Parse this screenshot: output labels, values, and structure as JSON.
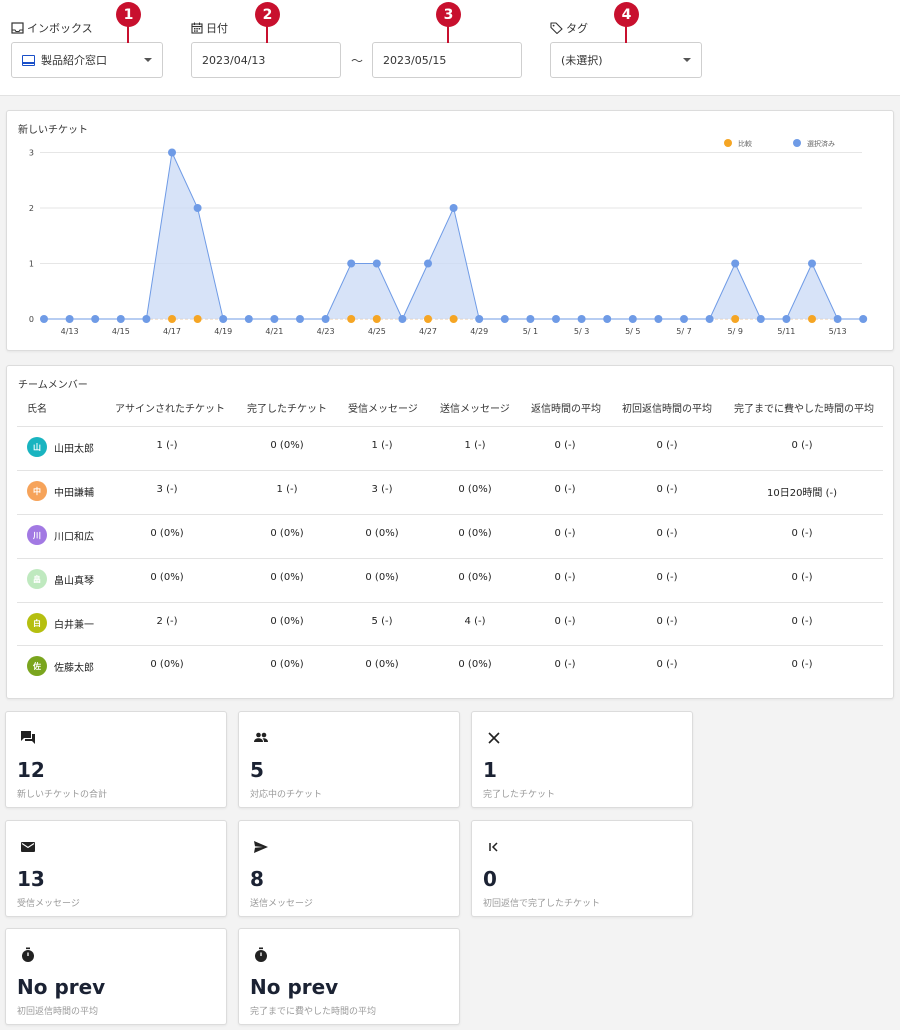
{
  "filters": {
    "inbox": {
      "label": "インボックス",
      "value": "製品紹介窓口",
      "badge": "1"
    },
    "date": {
      "label": "日付",
      "from": "2023/04/13",
      "to": "2023/05/15",
      "separator": "～",
      "badge_from": "2",
      "badge_to": "3"
    },
    "tag": {
      "label": "タグ",
      "value": "(未選択)",
      "badge": "4"
    },
    "badge_color": "#c8102e"
  },
  "chart": {
    "title": "新しいチケット",
    "legend": {
      "compare": "比較",
      "selected": "選択済み"
    },
    "colors": {
      "selected": "#6f9be6",
      "compare": "#f5a524",
      "fill": "#c9d9f5"
    }
  },
  "chart_data": {
    "type": "area",
    "x": [
      "4/13",
      "4/14",
      "4/15",
      "4/16",
      "4/17",
      "4/18",
      "4/19",
      "4/20",
      "4/21",
      "4/22",
      "4/23",
      "4/24",
      "4/25",
      "4/26",
      "4/27",
      "4/28",
      "4/29",
      "4/30",
      "5/1",
      "5/2",
      "5/3",
      "5/4",
      "5/5",
      "5/6",
      "5/7",
      "5/8",
      "5/9",
      "5/10",
      "5/11",
      "5/12",
      "5/13",
      "5/14"
    ],
    "tick_labels": [
      "4/13",
      "4/15",
      "4/17",
      "4/19",
      "4/21",
      "4/23",
      "4/25",
      "4/27",
      "4/29",
      "5/ 1",
      "5/ 3",
      "5/ 5",
      "5/ 7",
      "5/ 9",
      "5/11",
      "5/13"
    ],
    "y_ticks": [
      "0",
      "1",
      "2",
      "3"
    ],
    "ylim": [
      0,
      3
    ],
    "series": [
      {
        "name": "選択済み",
        "values": [
          0,
          0,
          0,
          0,
          0,
          3,
          2,
          0,
          0,
          0,
          0,
          0,
          1,
          1,
          0,
          1,
          2,
          0,
          0,
          0,
          0,
          0,
          0,
          0,
          0,
          0,
          0,
          1,
          0,
          0,
          1,
          0,
          0
        ]
      },
      {
        "name": "比較",
        "values": [
          null,
          null,
          null,
          null,
          null,
          0,
          0,
          null,
          null,
          null,
          null,
          null,
          0,
          0,
          null,
          0,
          0,
          null,
          null,
          null,
          null,
          null,
          null,
          null,
          null,
          null,
          null,
          0,
          null,
          null,
          0,
          null,
          null
        ]
      }
    ],
    "legend_position": "top-right",
    "grid": true
  },
  "team": {
    "title": "チームメンバー",
    "headers": [
      "氏名",
      "アサインされたチケット",
      "完了したチケット",
      "受信メッセージ",
      "送信メッセージ",
      "返信時間の平均",
      "初回返信時間の平均",
      "完了までに費やした時間の平均"
    ],
    "members": [
      {
        "initial": "山",
        "name": "山田太郎",
        "color": "#19b4c0",
        "cells": [
          "1 (-)",
          "0 (0%)",
          "1 (-)",
          "1 (-)",
          "0 (-)",
          "0 (-)",
          "0 (-)"
        ]
      },
      {
        "initial": "中",
        "name": "中田謙輔",
        "color": "#f6a35a",
        "cells": [
          "3 (-)",
          "1 (-)",
          "3 (-)",
          "0 (0%)",
          "0 (-)",
          "0 (-)",
          "10日20時間 (-)"
        ]
      },
      {
        "initial": "川",
        "name": "川口和広",
        "color": "#a279e3",
        "cells": [
          "0 (0%)",
          "0 (0%)",
          "0 (0%)",
          "0 (0%)",
          "0 (-)",
          "0 (-)",
          "0 (-)"
        ]
      },
      {
        "initial": "畠",
        "name": "畠山真琴",
        "color": "#bfe9bf",
        "cells": [
          "0 (0%)",
          "0 (0%)",
          "0 (0%)",
          "0 (0%)",
          "0 (-)",
          "0 (-)",
          "0 (-)"
        ]
      },
      {
        "initial": "白",
        "name": "白井兼一",
        "color": "#b5bf10",
        "cells": [
          "2 (-)",
          "0 (0%)",
          "5 (-)",
          "4 (-)",
          "0 (-)",
          "0 (-)",
          "0 (-)"
        ]
      },
      {
        "initial": "佐",
        "name": "佐藤太郎",
        "color": "#7aa51e",
        "cells": [
          "0 (0%)",
          "0 (0%)",
          "0 (0%)",
          "0 (0%)",
          "0 (-)",
          "0 (-)",
          "0 (-)"
        ]
      }
    ]
  },
  "stats": [
    {
      "icon": "chat-icon",
      "value": "12",
      "label": "新しいチケットの合計"
    },
    {
      "icon": "people-icon",
      "value": "5",
      "label": "対応中のチケット"
    },
    {
      "icon": "close-icon",
      "value": "1",
      "label": "完了したチケット"
    },
    {
      "icon": "mail-icon",
      "value": "13",
      "label": "受信メッセージ"
    },
    {
      "icon": "send-icon",
      "value": "8",
      "label": "送信メッセージ"
    },
    {
      "icon": "first-page-icon",
      "value": "0",
      "label": "初回返信で完了したチケット"
    },
    {
      "icon": "timer-icon",
      "value": "No prev",
      "label": "初回返信時間の平均"
    },
    {
      "icon": "timer-icon",
      "value": "No prev",
      "label": "完了までに費やした時間の平均"
    }
  ]
}
